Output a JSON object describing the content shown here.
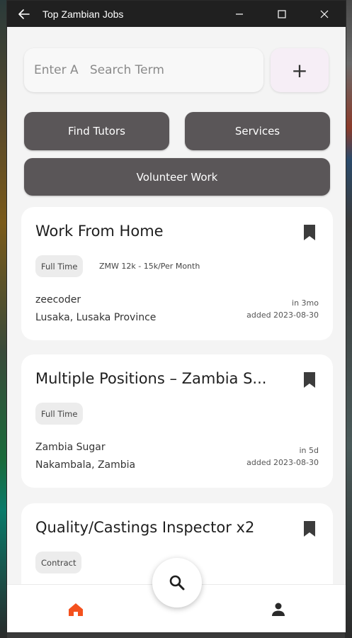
{
  "window": {
    "title": "Top Zambian Jobs"
  },
  "search": {
    "placeholder": "Enter A   Search Term",
    "add_label": "+"
  },
  "categories": {
    "find_tutors": "Find Tutors",
    "services": "Services",
    "volunteer": "Volunteer Work"
  },
  "jobs": [
    {
      "title": "Work From Home",
      "type": "Full Time",
      "salary": "ZMW 12k - 15k/Per Month",
      "company": "zeecoder",
      "location": "Lusaka, Lusaka Province",
      "posted": "in 3mo",
      "added": "added 2023-08-30"
    },
    {
      "title": "Multiple Positions – Zambia S...",
      "type": "Full Time",
      "company": "Zambia Sugar",
      "location": "Nakambala, Zambia",
      "posted": "in 5d",
      "added": "added 2023-08-30"
    },
    {
      "title": "Quality/Castings Inspector x2",
      "type": "Contract"
    }
  ],
  "colors": {
    "accent": "#f4511e",
    "pill_bg": "#5a5658",
    "titlebar": "#202020"
  },
  "icons": {
    "back": "arrow-left-icon",
    "bookmark": "bookmark-icon",
    "home": "home-icon",
    "profile": "person-icon",
    "search": "search-icon"
  }
}
